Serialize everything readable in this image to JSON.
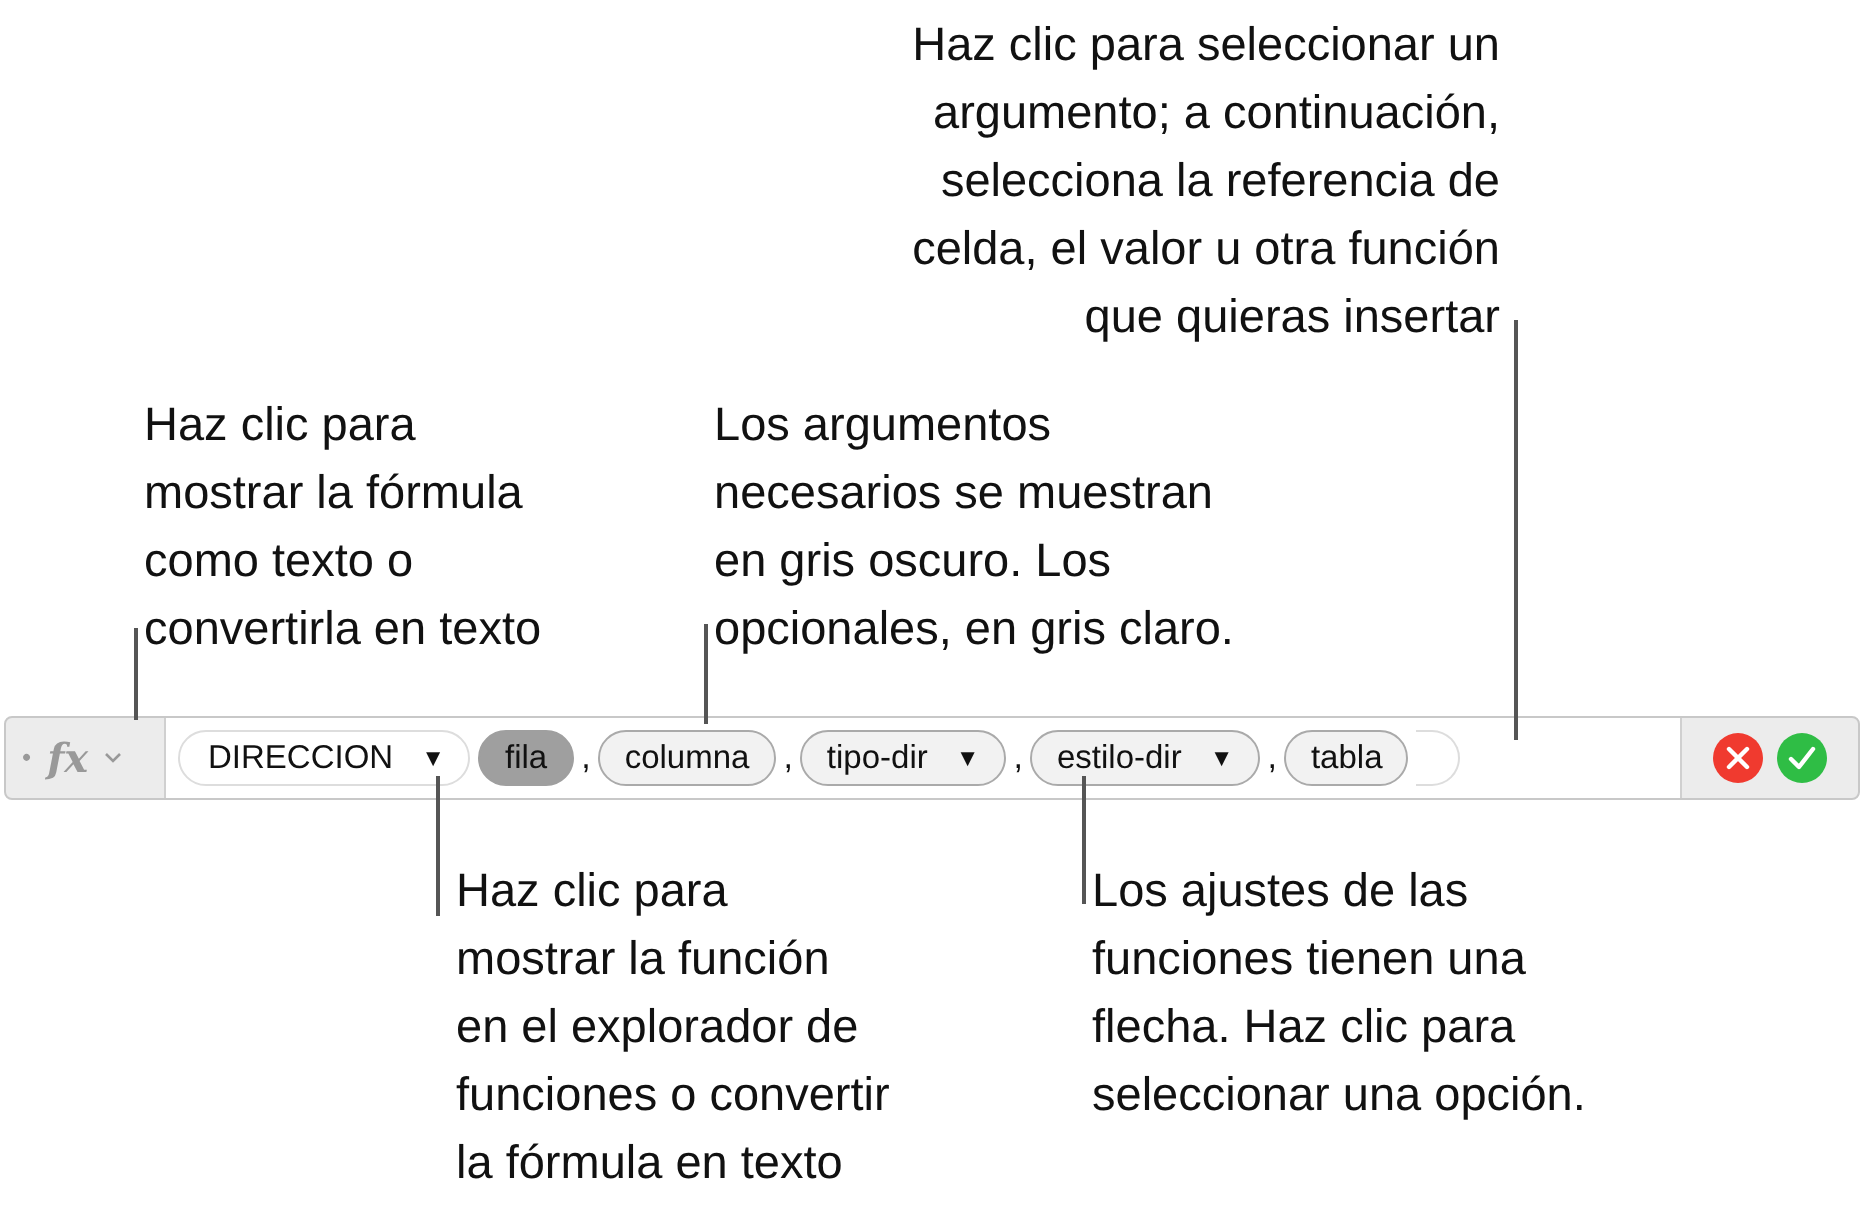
{
  "formula_bar": {
    "bullet": "•",
    "fx": "fx",
    "function": {
      "label": "DIRECCION",
      "arrow": "▼"
    },
    "arguments": [
      {
        "label": "fila",
        "selected": true
      },
      {
        "label": "columna",
        "selected": false
      },
      {
        "label": "tipo-dir",
        "selected": false,
        "arrow": "▼"
      },
      {
        "label": "estilo-dir",
        "selected": false,
        "arrow": "▼"
      },
      {
        "label": "tabla",
        "selected": false
      }
    ],
    "separator": ","
  },
  "callouts": [
    {
      "text": "Haz clic para seleccionar un\nargumento; a continuación,\nselecciona la referencia de\ncelda, el valor u otra función\nque quieras insertar"
    },
    {
      "text": "Haz clic para\nmostrar la fórmula\ncomo texto o\nconvertirla en texto"
    },
    {
      "text": "Los argumentos\nnecesarios se muestran\nen gris oscuro. Los\nopcionales, en gris claro."
    },
    {
      "text": "Haz clic para\nmostrar la función\nen el explorador de\nfunciones o convertir\nla fórmula en texto"
    },
    {
      "text": "Los ajustes de las\nfunciones tienen una\nflecha. Haz clic para\nseleccionar una opción."
    }
  ]
}
